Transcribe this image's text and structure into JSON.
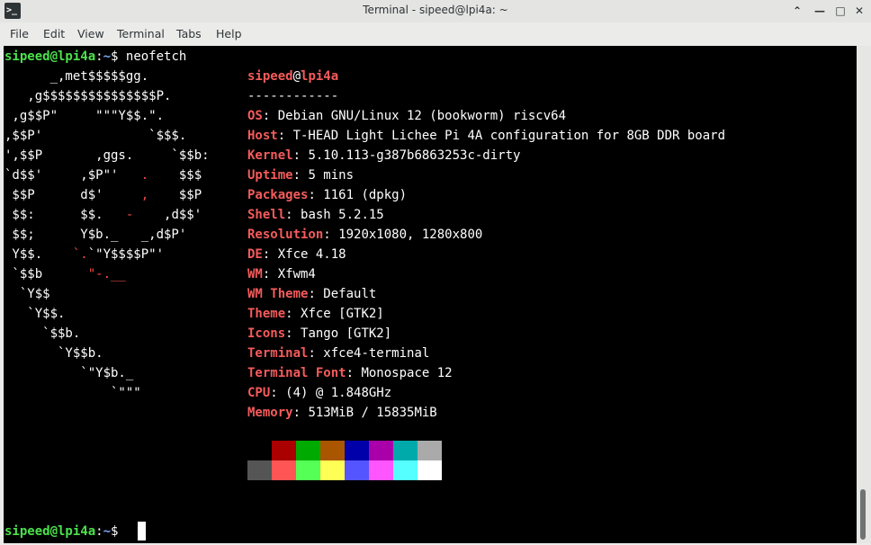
{
  "window": {
    "title": "Terminal - sipeed@lpi4a: ~"
  },
  "menu": [
    "File",
    "Edit",
    "View",
    "Terminal",
    "Tabs",
    "Help"
  ],
  "prompt": {
    "user": "sipeed@lpi4a",
    "sep": ":",
    "path": "~",
    "dollar": "$ ",
    "command": "neofetch"
  },
  "logo": [
    [
      [
        "      _,met$$$$$gg.",
        "w"
      ]
    ],
    [
      [
        "   ,g$$$$$$$$$$$$$$$P.",
        "w"
      ]
    ],
    [
      [
        " ,g$$P\"     \"\"\"Y$$.\".",
        "w"
      ]
    ],
    [
      [
        ",$$P'              `$$$.",
        "w"
      ]
    ],
    [
      [
        "',$$P       ,ggs.     `$$b:",
        "w"
      ]
    ],
    [
      [
        "`d$$'     ,$P\"'   ",
        "w"
      ],
      [
        ".",
        "r"
      ],
      [
        "    $$$",
        "w"
      ]
    ],
    [
      [
        " $$P      d$'     ",
        "w"
      ],
      [
        ",",
        "r"
      ],
      [
        "    $$P",
        "w"
      ]
    ],
    [
      [
        " $$:      $$.   ",
        "w"
      ],
      [
        "-",
        "r"
      ],
      [
        "    ,d$$'",
        "w"
      ]
    ],
    [
      [
        " $$;      Y$b._   _,d$P'",
        "w"
      ]
    ],
    [
      [
        " Y$$.    ",
        "w"
      ],
      [
        "`.",
        "r"
      ],
      [
        "`\"Y$$$$P\"'",
        "w"
      ]
    ],
    [
      [
        " `$$b      ",
        "w"
      ],
      [
        "\"-.__",
        "r"
      ]
    ],
    [
      [
        "  `Y$$",
        "w"
      ]
    ],
    [
      [
        "   `Y$$.",
        "w"
      ]
    ],
    [
      [
        "     `$$b.",
        "w"
      ]
    ],
    [
      [
        "       `Y$$b.",
        "w"
      ]
    ],
    [
      [
        "          `\"Y$b._",
        "w"
      ]
    ],
    [
      [
        "              `\"\"\"",
        "w"
      ]
    ]
  ],
  "info": {
    "user": "sipeed",
    "at": "@",
    "host": "lpi4a",
    "separator": "------------",
    "rows": [
      {
        "key": "OS",
        "value": "Debian GNU/Linux 12 (bookworm) riscv64"
      },
      {
        "key": "Host",
        "value": "T-HEAD Light Lichee Pi 4A configuration for 8GB DDR board"
      },
      {
        "key": "Kernel",
        "value": "5.10.113-g387b6863253c-dirty"
      },
      {
        "key": "Uptime",
        "value": "5 mins"
      },
      {
        "key": "Packages",
        "value": "1161 (dpkg)"
      },
      {
        "key": "Shell",
        "value": "bash 5.2.15"
      },
      {
        "key": "Resolution",
        "value": "1920x1080, 1280x800"
      },
      {
        "key": "DE",
        "value": "Xfce 4.18"
      },
      {
        "key": "WM",
        "value": "Xfwm4"
      },
      {
        "key": "WM Theme",
        "value": "Default"
      },
      {
        "key": "Theme",
        "value": "Xfce [GTK2]"
      },
      {
        "key": "Icons",
        "value": "Tango [GTK2]"
      },
      {
        "key": "Terminal",
        "value": "xfce4-terminal"
      },
      {
        "key": "Terminal Font",
        "value": "Monospace 12"
      },
      {
        "key": "CPU",
        "value": "(4) @ 1.848GHz"
      },
      {
        "key": "Memory",
        "value": "513MiB / 15835MiB"
      }
    ]
  },
  "palette": {
    "normal": [
      "#000000",
      "#aa0000",
      "#00aa00",
      "#aa5500",
      "#0000aa",
      "#aa00aa",
      "#00aaaa",
      "#aaaaaa"
    ],
    "bright": [
      "#555555",
      "#ff5555",
      "#55ff55",
      "#ffff55",
      "#5555ff",
      "#ff55ff",
      "#55ffff",
      "#ffffff"
    ]
  }
}
